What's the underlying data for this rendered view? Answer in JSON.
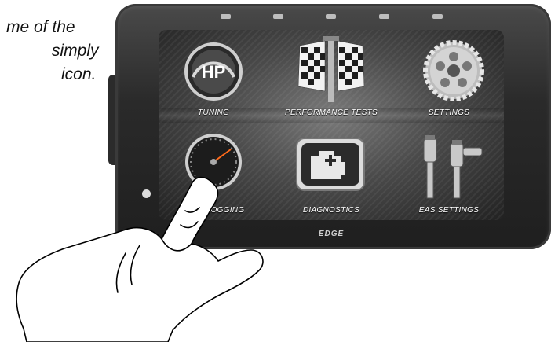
{
  "caption": {
    "line1": "me of the",
    "line2": "simply",
    "line3": "icon."
  },
  "screen": {
    "menu": [
      {
        "label": "TUNING",
        "icon": "hp-gauge-icon",
        "badge": "HP"
      },
      {
        "label": "PERFORMANCE TESTS",
        "icon": "checkered-flags-icon"
      },
      {
        "label": "SETTINGS",
        "icon": "gear-icon"
      },
      {
        "label": "& LOGGING",
        "icon": "gauge-icon",
        "label_prefix": "G"
      },
      {
        "label": "DIAGNOSTICS",
        "icon": "engine-icon"
      },
      {
        "label": "EAS SETTINGS",
        "icon": "eas-sensors-icon"
      }
    ]
  },
  "device": {
    "brand": "EDGE"
  },
  "colors": {
    "bezel": "#2a2a2a",
    "screen": "#4a4a4a",
    "label": "#ffffff"
  }
}
